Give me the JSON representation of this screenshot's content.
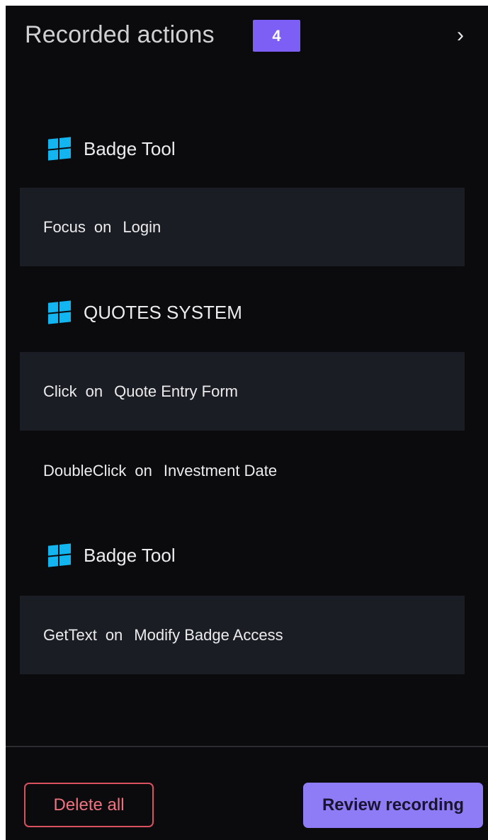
{
  "header": {
    "title": "Recorded actions",
    "count": "4",
    "collapse_glyph": "›"
  },
  "groups": [
    {
      "app_icon": "windows-icon",
      "app_name": "Badge Tool",
      "actions": [
        {
          "verb": "Focus",
          "on": "on",
          "target": "Login"
        }
      ]
    },
    {
      "app_icon": "windows-icon",
      "app_name": "QUOTES SYSTEM",
      "actions": [
        {
          "verb": "Click",
          "on": "on",
          "target": "Quote Entry Form"
        },
        {
          "verb": "DoubleClick",
          "on": "on",
          "target": "Investment Date"
        }
      ]
    },
    {
      "app_icon": "windows-icon",
      "app_name": "Badge Tool",
      "actions": [
        {
          "verb": "GetText",
          "on": "on",
          "target": "Modify Badge Access"
        }
      ]
    }
  ],
  "footer": {
    "delete_label": "Delete all",
    "review_label": "Review recording"
  },
  "colors": {
    "background": "#0b0b0e",
    "row_background": "#1b1d24",
    "accent": "#7d5ff5",
    "review_button": "#8e7cf7",
    "delete_border": "#d9505f",
    "windows_icon": "#12b5ef"
  }
}
